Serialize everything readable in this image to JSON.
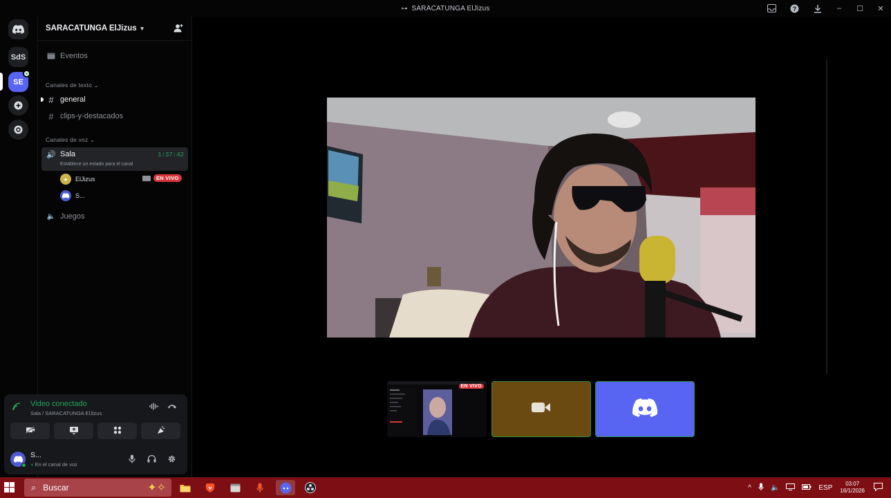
{
  "window": {
    "title": "SARACATUNGA ElJizus",
    "controls": [
      "inbox-icon",
      "help-icon",
      "download-icon",
      "minimize-icon",
      "maximize-icon",
      "close-icon"
    ]
  },
  "rail": {
    "items": [
      {
        "name": "home",
        "label": ""
      },
      {
        "name": "server-sds",
        "label": "SdS"
      },
      {
        "name": "server-se",
        "label": "SE"
      },
      {
        "name": "add-server",
        "label": "+"
      },
      {
        "name": "discover",
        "label": "⊘"
      }
    ]
  },
  "server": {
    "name": "SARACATUNGA ElJizus",
    "events_label": "Eventos",
    "text_category": "Canales de texto",
    "text_channels": [
      "general",
      "clips-y-destacados"
    ],
    "voice_category": "Canales de voz",
    "voice_channel": {
      "name": "Sala",
      "timer": "1:37:42",
      "status": "Establece un estado para el canal",
      "users": [
        {
          "name": "ElJizus",
          "live": "EN VIVO"
        },
        {
          "name": "S..."
        }
      ]
    },
    "other_voice": "Juegos"
  },
  "voice_panel": {
    "title": "Video conectado",
    "subtitle": "Sala / SARACATUNGA ElJizus",
    "buttons": [
      "camera-off-icon",
      "screen-share-icon",
      "activities-icon",
      "soundboard-icon"
    ],
    "user_name": "S...",
    "user_status": "En el canal de voz"
  },
  "stage": {
    "preview_badge": "EN VIVO"
  },
  "taskbar": {
    "search_placeholder": "Buscar",
    "language": "ESP",
    "time": "03:07",
    "date": "16/1/2026"
  },
  "colors": {
    "blurple": "#5865f2",
    "green": "#23a55a",
    "live_red": "#da373c",
    "taskbar": "#7d0f14"
  }
}
